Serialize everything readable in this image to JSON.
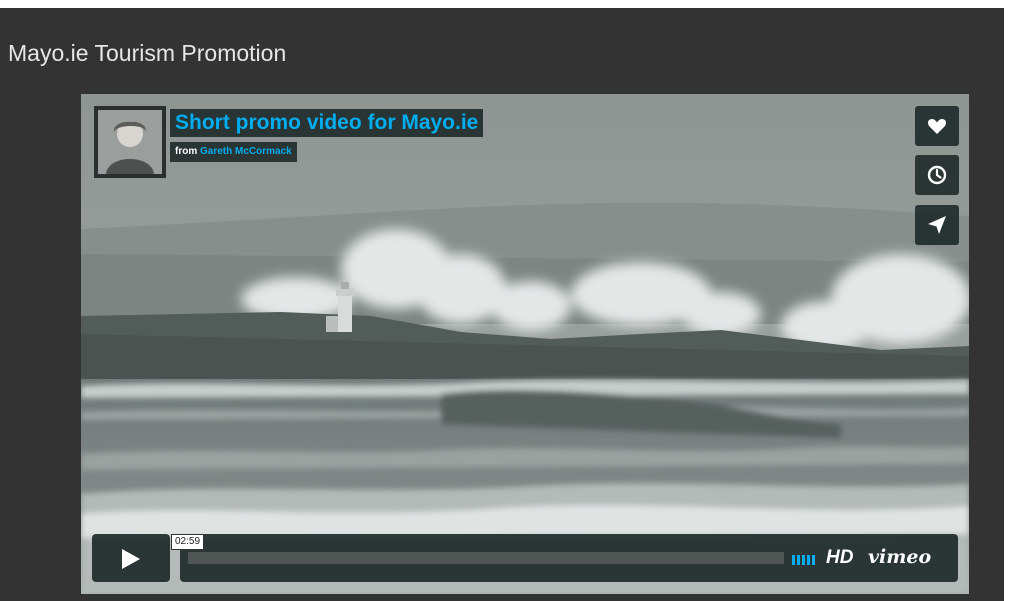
{
  "page": {
    "title": "Mayo.ie Tourism Promotion"
  },
  "video": {
    "title": "Short promo video for Mayo.ie",
    "byline_prefix": "from",
    "author": "Gareth McCormack",
    "duration": "02:59",
    "progress": 0,
    "hd_label": "HD",
    "brand": "vimeo"
  },
  "side_buttons": [
    {
      "name": "like",
      "icon": "heart-icon"
    },
    {
      "name": "watch-later",
      "icon": "clock-icon"
    },
    {
      "name": "share",
      "icon": "paper-plane-icon"
    }
  ],
  "colors": {
    "page_background": "#333333",
    "title_text": "#e6e6e6",
    "accent": "#00adef",
    "overlay": "#172323"
  }
}
